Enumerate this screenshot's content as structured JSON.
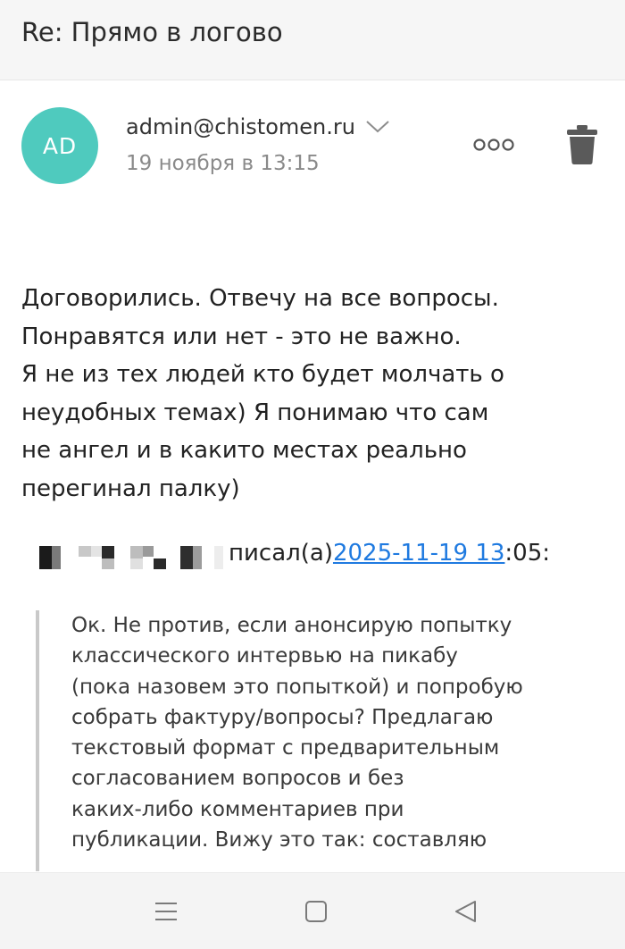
{
  "header": {
    "subject": "Re: Прямо в логово"
  },
  "message": {
    "avatar_initials": "AD",
    "avatar_color": "#4fcabe",
    "sender": "admin@chistomen.ru",
    "date": "19 ноября в 13:15",
    "icons": {
      "expand": "chevron-down-icon",
      "more": "more-dots-icon",
      "delete": "trash-icon"
    }
  },
  "body": {
    "lines": [
      "Договорились. Отвечу на все вопросы.",
      "Понравятся или нет - это не важно.",
      "Я не из тех людей кто будет молчать о",
      "неудобных темах) Я понимаю что сам",
      "не ангел и в какито местах реально",
      "перегинал палку)"
    ]
  },
  "quote": {
    "wrote_label": "писал(а) ",
    "link_text": "2025-11-19 13",
    "time_suffix": ":05:",
    "link_color": "#1f7ae0",
    "lines": [
      "Ок. Не против, если анонсирую попытку",
      "классического интервью на пикабу",
      "(пока назовем это попыткой) и попробую",
      "собрать фактуру/вопросы? Предлагаю",
      "текстовый формат с предварительным",
      "согласованием вопросов и без",
      "каких-либо комментариев при",
      "публикации. Вижу это так: составляю"
    ]
  },
  "navbar": {
    "icons": [
      "menu-icon",
      "home-square-icon",
      "back-triangle-icon"
    ]
  }
}
